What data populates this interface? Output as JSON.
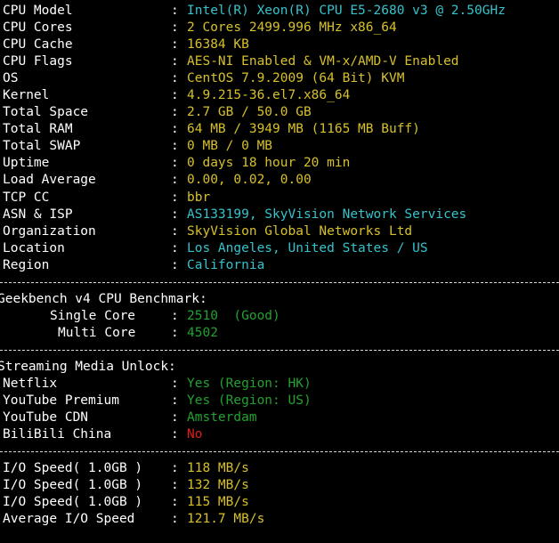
{
  "colors": {
    "key": "#ffffff",
    "cyan": "#35c3cc",
    "yellow": "#d7c02a",
    "green": "#23a130",
    "red": "#e01b1b"
  },
  "system_info": [
    {
      "key": "CPU Model",
      "value": "Intel(R) Xeon(R) CPU E5-2680 v3 @ 2.50GHz",
      "color": "cyan"
    },
    {
      "key": "CPU Cores",
      "value": "2 Cores 2499.996 MHz x86_64",
      "color": "yellow"
    },
    {
      "key": "CPU Cache",
      "value": "16384 KB",
      "color": "yellow"
    },
    {
      "key": "CPU Flags",
      "value": "AES-NI Enabled & VM-x/AMD-V Enabled",
      "color": "yellow"
    },
    {
      "key": "OS",
      "value": "CentOS 7.9.2009 (64 Bit) KVM",
      "color": "yellow"
    },
    {
      "key": "Kernel",
      "value": "4.9.215-36.el7.x86_64",
      "color": "yellow"
    },
    {
      "key": "Total Space",
      "value": "2.7 GB / 50.0 GB",
      "color": "yellow"
    },
    {
      "key": "Total RAM",
      "value": "64 MB / 3949 MB (1165 MB Buff)",
      "color": "yellow"
    },
    {
      "key": "Total SWAP",
      "value": "0 MB / 0 MB",
      "color": "yellow"
    },
    {
      "key": "Uptime",
      "value": "0 days 18 hour 20 min",
      "color": "yellow"
    },
    {
      "key": "Load Average",
      "value": "0.00, 0.02, 0.00",
      "color": "yellow"
    },
    {
      "key": "TCP CC",
      "value": "bbr",
      "color": "yellow"
    },
    {
      "key": "ASN & ISP",
      "value": "AS133199, SkyVision Network Services",
      "color": "cyan"
    },
    {
      "key": "Organization",
      "value": "SkyVision Global Networks Ltd",
      "color": "yellow"
    },
    {
      "key": "Location",
      "value": "Los Angeles, United States / US",
      "color": "cyan"
    },
    {
      "key": "Region",
      "value": "California",
      "color": "cyan"
    }
  ],
  "separator": ":",
  "geekbench": {
    "title": "Geekbench v4 CPU Benchmark:",
    "rows": [
      {
        "key": "Single Core",
        "value": "2510  (Good)",
        "color": "green"
      },
      {
        "key": "Multi Core",
        "value": "4502",
        "color": "green"
      }
    ]
  },
  "streaming": {
    "title": "Streaming Media Unlock:",
    "rows": [
      {
        "key": "Netflix",
        "value": "Yes (Region: HK)",
        "color": "green"
      },
      {
        "key": "YouTube Premium",
        "value": "Yes (Region: US)",
        "color": "green"
      },
      {
        "key": "YouTube CDN",
        "value": "Amsterdam",
        "color": "green"
      },
      {
        "key": "BiliBili China",
        "value": "No",
        "color": "red"
      }
    ]
  },
  "io_speed": [
    {
      "key": "I/O Speed( 1.0GB )",
      "value": "118 MB/s",
      "color": "yellow"
    },
    {
      "key": "I/O Speed( 1.0GB )",
      "value": "132 MB/s",
      "color": "yellow"
    },
    {
      "key": "I/O Speed( 1.0GB )",
      "value": "115 MB/s",
      "color": "yellow"
    },
    {
      "key": "Average I/O Speed",
      "value": "121.7 MB/s",
      "color": "yellow"
    }
  ]
}
